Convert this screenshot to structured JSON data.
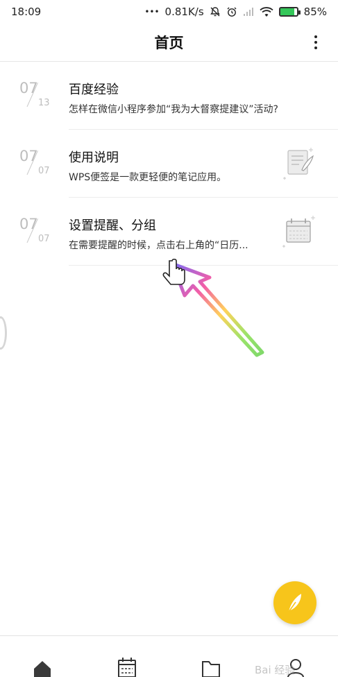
{
  "status_bar": {
    "time": "18:09",
    "dots": "•••",
    "speed": "0.81K/s",
    "battery_percent": "85%",
    "battery_level": 0.85
  },
  "header": {
    "title": "首页"
  },
  "notes": [
    {
      "month": "07",
      "day": "13",
      "title": "百度经验",
      "subtitle": "怎样在微信小程序参加“我为大督察提建议”活动?"
    },
    {
      "month": "07",
      "day": "07",
      "title": "使用说明",
      "subtitle": "WPS便签是一款更轻便的笔记应用。"
    },
    {
      "month": "07",
      "day": "07",
      "title": "设置提醒、分组",
      "subtitle": "在需要提醒的时候，点击右上角的“日历..."
    }
  ],
  "bottom_nav": [
    "home-icon",
    "calendar-icon",
    "folder-icon",
    "profile-icon"
  ],
  "watermark": "Bai 经验",
  "colors": {
    "accent": "#f7c51b",
    "battery_fill": "#34c759"
  }
}
